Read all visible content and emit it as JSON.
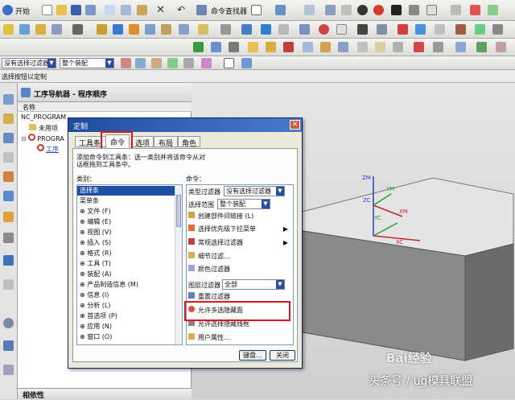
{
  "toolbar1": {
    "start": "开始",
    "command_finder": "命令查找器"
  },
  "toolbar3": {
    "filter_value": "没有选择过滤器",
    "assembly_value": "整个装配"
  },
  "toolbar4": {
    "hint": "选择按钮以定制"
  },
  "navigator": {
    "title": "工序导航器 - 程序顺序",
    "col_name": "名称",
    "rows": [
      "NC_PROGRAM",
      "未用项",
      "PROGRA",
      "工序"
    ]
  },
  "dialog": {
    "title": "定制",
    "tabs": [
      "工具条",
      "命令",
      "选项",
      "布局",
      "角色"
    ],
    "instruction": "添加命令到工具条：选一类别并将该命令从对话框拖到工具条中。",
    "category_label": "类别：",
    "command_label": "命令：",
    "categories": [
      "选择条",
      "菜单条",
      "文件 (F)",
      "编辑 (E)",
      "视图 (V)",
      "插入 (S)",
      "格式 (R)",
      "工具 (T)",
      "装配 (A)",
      "产品制造信息 (M)",
      "信息 (I)",
      "分析 (L)",
      "首选项 (P)",
      "应用 (N)",
      "窗口 (O)"
    ],
    "type_filter_label": "类型过滤器",
    "type_filter_value": "没有选择过滤器",
    "scope_label": "选择范围",
    "scope_value": "整个装配",
    "commands": [
      "创建部件间链接 (L)",
      "选择优先级下拉菜单",
      "常规选择过滤器",
      "细节过滤...",
      "颜色过滤器"
    ],
    "layer_filter_label": "图层过滤器",
    "layer_filter_value": "全部",
    "commands2": [
      "重置过滤器",
      "允许多选隐藏面",
      "允许选择隐藏线框",
      "用户属性..."
    ],
    "ok_button": "键盘...",
    "close_button": "关闭"
  },
  "view": {
    "axes": [
      "ZM",
      "YM",
      "XM",
      "ZC",
      "YC",
      "XC"
    ]
  },
  "bottom": {
    "panel_label": "相依性"
  },
  "watermark": {
    "brand": "Bai经验",
    "source": "头条号 / ug模具联盟"
  },
  "colors": {
    "dialog_bg": "#ece9d8",
    "title_bar": "#1e4da0",
    "highlight_red": "#e0141e",
    "selection": "#1f4fa6"
  }
}
